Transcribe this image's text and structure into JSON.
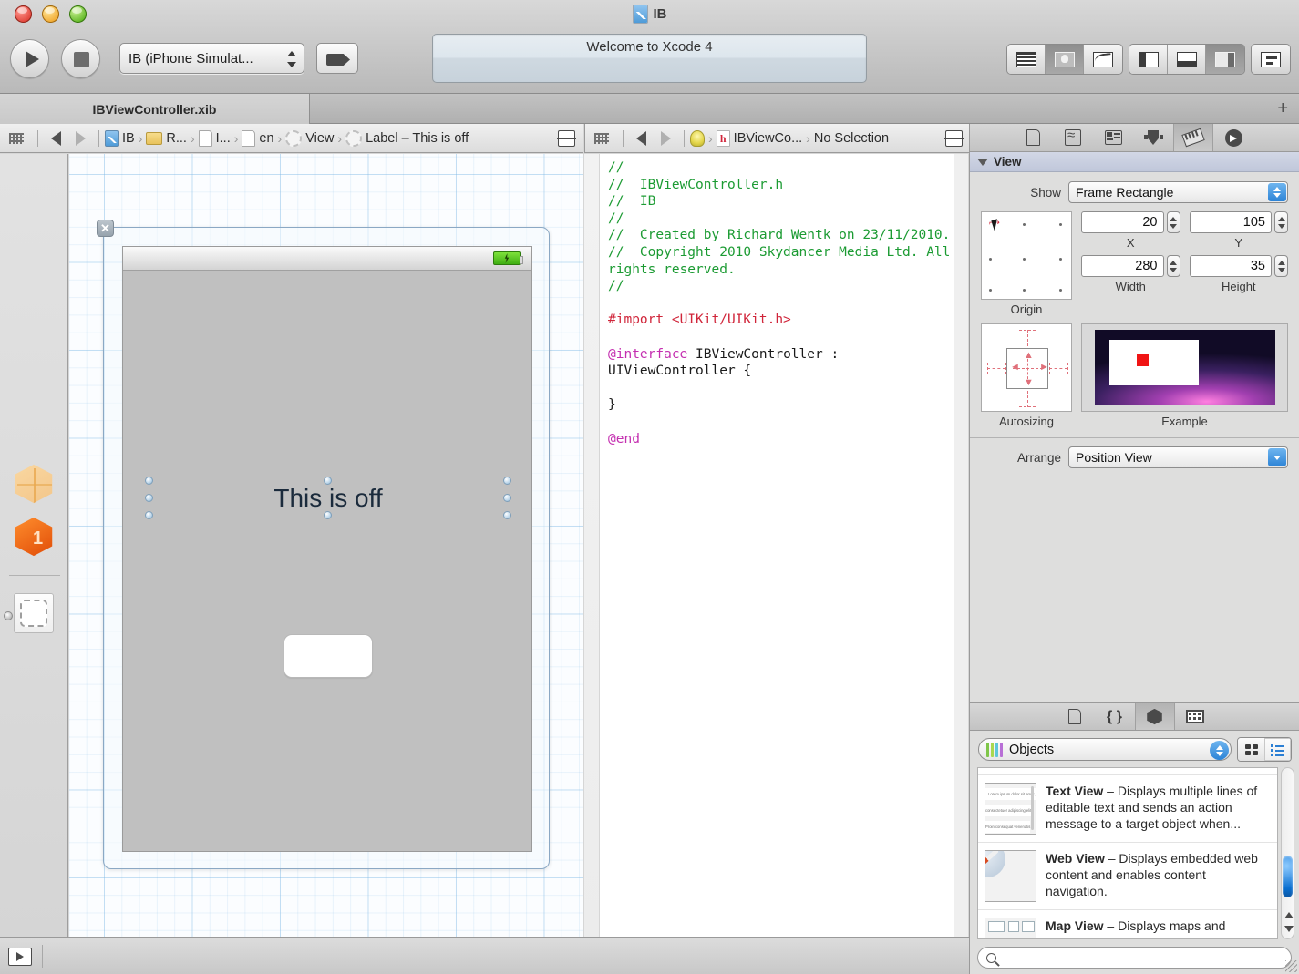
{
  "window": {
    "title": "IB",
    "traffic_lights": [
      "close",
      "minimize",
      "zoom"
    ]
  },
  "toolbar": {
    "run_label": "Run",
    "stop_label": "Stop",
    "scheme": "IB (iPhone Simulat...",
    "breakpoint_label": "Breakpoints",
    "status_message": "Welcome to Xcode 4",
    "editor_segments": [
      {
        "name": "standard-editor",
        "selected": false
      },
      {
        "name": "assistant-editor",
        "selected": true
      },
      {
        "name": "version-editor",
        "selected": false
      }
    ],
    "view_segments": [
      {
        "name": "navigator-toggle",
        "selected": false
      },
      {
        "name": "debug-area-toggle",
        "selected": false
      },
      {
        "name": "utilities-toggle",
        "selected": true
      }
    ],
    "organizer_label": "Organizer"
  },
  "tabs": {
    "active": "IBViewController.xib",
    "add_label": "+"
  },
  "canvas_jumpbar": {
    "back_label": "Back",
    "forward_label": "Forward",
    "crumbs": [
      {
        "icon": "xcode-project-icon",
        "label": "IB"
      },
      {
        "icon": "folder-icon",
        "label": "R..."
      },
      {
        "icon": "document-icon",
        "label": "I..."
      },
      {
        "icon": "document-icon",
        "label": "en"
      },
      {
        "icon": "object-icon",
        "label": "View"
      },
      {
        "icon": "object-icon",
        "label": "Label – This is off"
      }
    ]
  },
  "editor_jumpbar": {
    "back_label": "Back",
    "forward_label": "Forward",
    "crumbs": [
      {
        "icon": "related-items-icon",
        "label": ""
      },
      {
        "icon": "header-file-icon",
        "label": "IBViewCo..."
      },
      {
        "icon": "",
        "label": "No Selection"
      }
    ]
  },
  "dock": {
    "items": [
      {
        "name": "files-owner",
        "label": "File's Owner"
      },
      {
        "name": "first-responder",
        "label": "First Responder",
        "badge": "1"
      },
      {
        "name": "view-object",
        "label": "View"
      }
    ]
  },
  "design_canvas": {
    "label_text": "This is off",
    "status_bar": {
      "battery": "charging"
    },
    "text_field_value": ""
  },
  "code": {
    "lines": [
      {
        "type": "comment",
        "text": "//"
      },
      {
        "type": "comment",
        "text": "//  IBViewController.h"
      },
      {
        "type": "comment",
        "text": "//  IB"
      },
      {
        "type": "comment",
        "text": "//"
      },
      {
        "type": "comment",
        "text": "//  Created by Richard Wentk on 23/11/2010."
      },
      {
        "type": "comment",
        "text": "//  Copyright 2010 Skydancer Media Ltd. All rights reserved."
      },
      {
        "type": "comment",
        "text": "//"
      },
      {
        "type": "blank",
        "text": ""
      },
      {
        "type": "import",
        "keyword": "#import",
        "value": " <UIKit/UIKit.h>"
      },
      {
        "type": "blank",
        "text": ""
      },
      {
        "type": "interface",
        "keyword": "@interface",
        "value": " IBViewController : UIViewController {"
      },
      {
        "type": "blank",
        "text": ""
      },
      {
        "type": "plain",
        "text": "}"
      },
      {
        "type": "blank",
        "text": ""
      },
      {
        "type": "keyword",
        "text": "@end"
      }
    ]
  },
  "inspector": {
    "tabs": [
      {
        "name": "file-inspector",
        "selected": false
      },
      {
        "name": "quick-help-inspector",
        "selected": false
      },
      {
        "name": "identity-inspector",
        "selected": false
      },
      {
        "name": "attributes-inspector",
        "selected": false
      },
      {
        "name": "size-inspector",
        "selected": true
      },
      {
        "name": "connections-inspector",
        "selected": false
      }
    ],
    "section_title": "View",
    "show_label": "Show",
    "show_value": "Frame Rectangle",
    "origin_caption": "Origin",
    "x_label": "X",
    "x_value": "20",
    "y_label": "Y",
    "y_value": "105",
    "width_label": "Width",
    "width_value": "280",
    "height_label": "Height",
    "height_value": "35",
    "autosizing_caption": "Autosizing",
    "example_caption": "Example",
    "arrange_label": "Arrange",
    "arrange_value": "Position View"
  },
  "library": {
    "tabs": [
      {
        "name": "file-template-library",
        "selected": false
      },
      {
        "name": "code-snippet-library",
        "selected": false
      },
      {
        "name": "object-library",
        "selected": true
      },
      {
        "name": "media-library",
        "selected": false
      }
    ],
    "selector_value": "Objects",
    "view_modes": [
      {
        "name": "grid-view",
        "selected": false
      },
      {
        "name": "list-view",
        "selected": true
      }
    ],
    "items": [
      {
        "thumb": "text-view-icon",
        "title": "Text View",
        "dash": " – ",
        "desc": "Displays multiple lines of editable text and sends an action message to a target object when..."
      },
      {
        "thumb": "web-view-icon",
        "title": "Web View",
        "dash": " – ",
        "desc": "Displays embedded web content and enables content navigation."
      },
      {
        "thumb": "map-view-icon",
        "title": "Map View",
        "dash": " – ",
        "desc": "Displays maps and"
      }
    ],
    "thumb_lorem": "Lorem ipsum dolor sit amet, consectetuer adipiscing elit. Proin consequat venenatis turpis. Quisque et nulla.",
    "search_placeholder": ""
  },
  "bottom_bar": {
    "toggle_label": "Show Document Outline"
  },
  "colors": {
    "accent_blue": "#2c83d6",
    "comment_green": "#1c9b33",
    "string_red": "#d0253a",
    "keyword_magenta": "#c42fb0",
    "canvas_grid": "#84bce6",
    "label_text": "#1b2b3c",
    "battery_green": "#3fae12"
  }
}
